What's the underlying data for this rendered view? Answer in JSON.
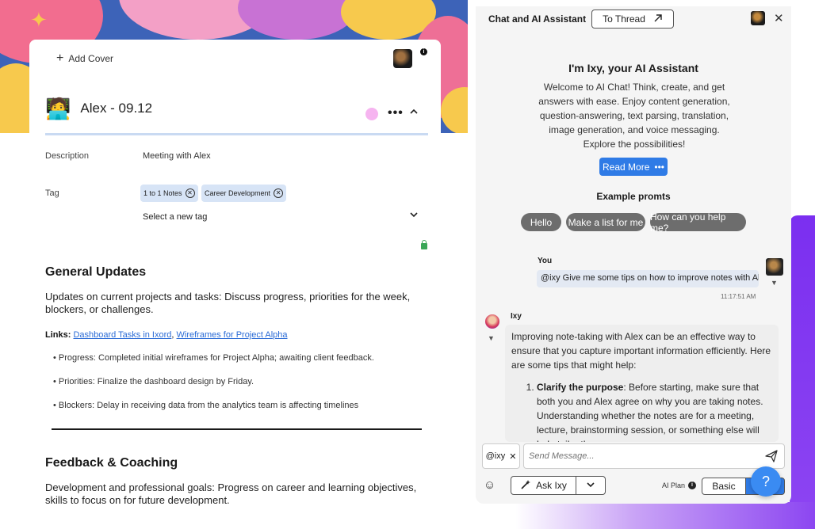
{
  "note": {
    "add_cover_label": "Add Cover",
    "title_emoji": "🧑‍💻",
    "title": "Alex - 09.12",
    "more_label": "•••",
    "description_label": "Description",
    "description_value": "Meeting with Alex",
    "tag_label": "Tag",
    "tags": [
      "1 to 1 Notes",
      "Career Development"
    ],
    "select_tag_placeholder": "Select a new tag"
  },
  "content": {
    "general_updates_heading": "General Updates",
    "general_updates_text": "Updates on current projects and tasks: Discuss progress, priorities for the week, blockers, or challenges.",
    "links_label": "Links:",
    "link_1": "Dashboard Tasks in Ixord",
    "link_separator": ",",
    "link_2": "Wireframes for Project Alpha",
    "bullets": [
      "• Progress: Completed initial wireframes for Project Alpha; awaiting client feedback.",
      "• Priorities: Finalize the dashboard design by Friday.",
      "• Blockers: Delay in receiving data from the analytics team is affecting timelines"
    ],
    "feedback_heading": "Feedback & Coaching",
    "feedback_text": "Development and professional goals: Progress on career and learning objectives, skills to focus on for future development."
  },
  "chat": {
    "title": "Chat and AI Assistant",
    "to_thread_label": "To Thread",
    "intro_title": "I'm Ixy, your AI Assistant",
    "intro_text": "Welcome to AI Chat! Think, create, and get answers with ease. Enjoy content generation, question-answering, text parsing, translation, image generation, and voice messaging. Explore the possibilities!",
    "read_more_label": "Read More",
    "read_more_dots": "•••",
    "examples_title": "Example promts",
    "example_prompts": [
      "Hello",
      "Make a list for me",
      "How can you help me?"
    ],
    "user_label": "You",
    "user_message": "@ixy Give me some tips on how to improve notes with Alex",
    "user_time": "11:17:51 AM",
    "assistant_label": "Ixy",
    "assistant_intro": "Improving note-taking with Alex can be an effective way to ensure that you capture important information efficiently. Here are some tips that might help:",
    "assistant_tip_1_title": "Clarify the purpose",
    "assistant_tip_1_text": ": Before starting, make sure that both you and Alex agree on why you are taking notes. Understanding whether the notes are for a meeting, lecture, brainstorming session, or something else will help tailor the",
    "mention_chip": "@ixy",
    "input_placeholder": "Send Message...",
    "ask_label": "Ask Ixy",
    "ai_plan_label": "AI Plan",
    "plan_basic_label": "Basic",
    "help_label": "?"
  },
  "colors": {
    "accent_blue": "#2f7be6",
    "purple_accent": "#7b2ff0",
    "cover_blue": "#3d63b8"
  }
}
